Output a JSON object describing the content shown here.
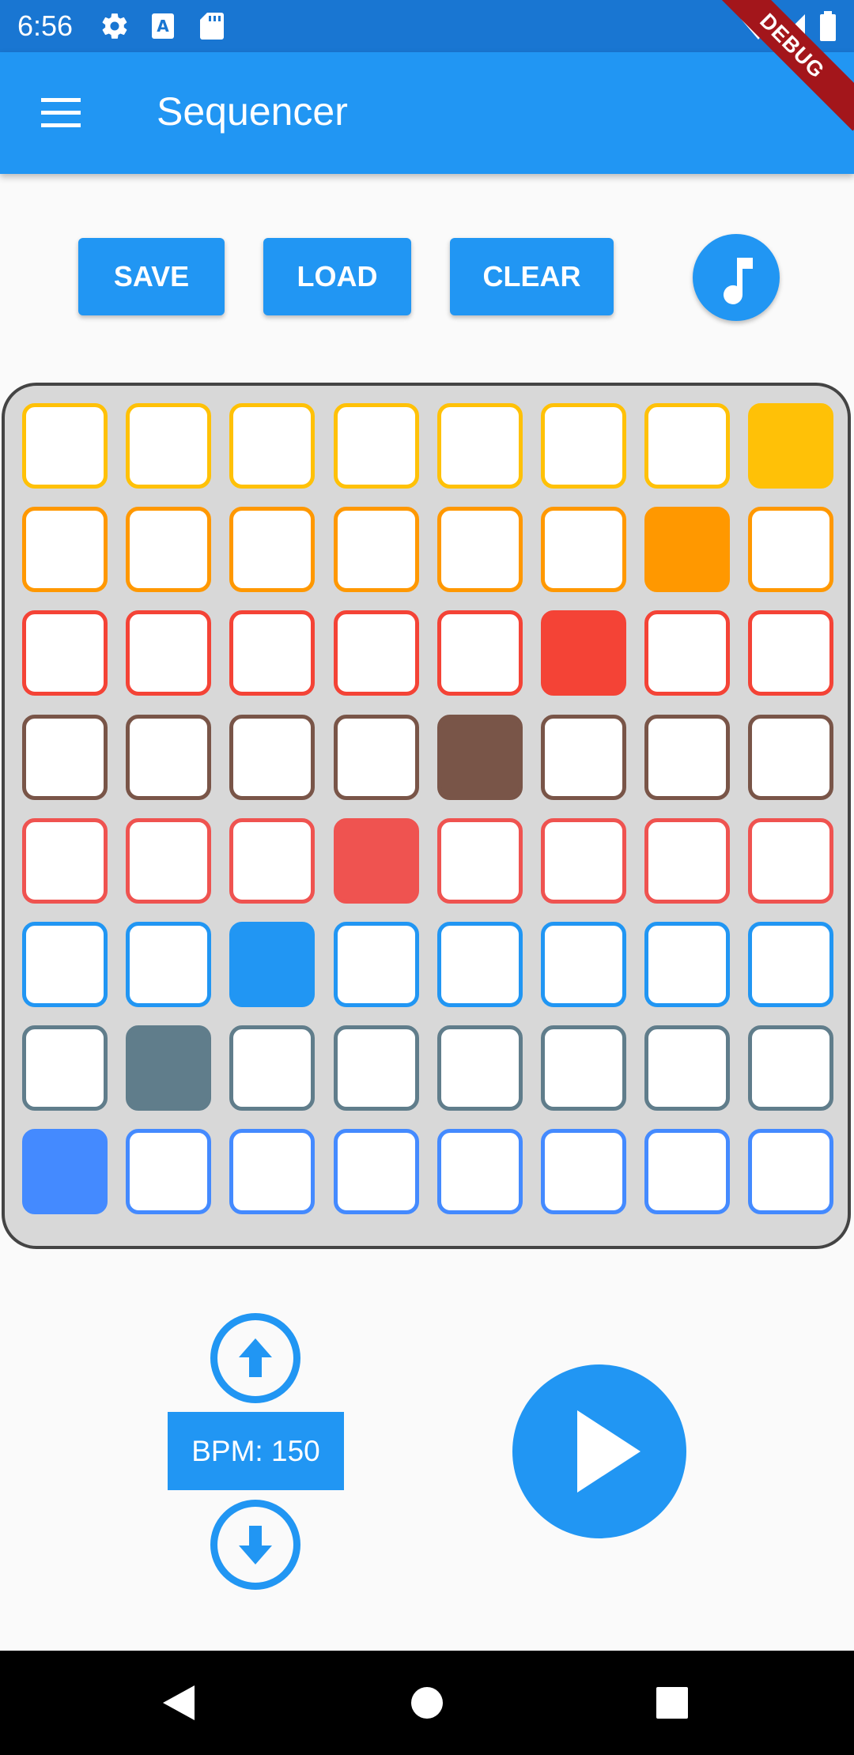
{
  "status_bar": {
    "time": "6:56"
  },
  "app_bar": {
    "title": "Sequencer",
    "debug_banner": "DEBUG"
  },
  "toolbar": {
    "save_label": "SAVE",
    "load_label": "LOAD",
    "clear_label": "CLEAR",
    "music_icon": "music-note-icon"
  },
  "grid": {
    "columns": 8,
    "rows": [
      {
        "color": "#ffc107",
        "active_step": 8
      },
      {
        "color": "#ff9800",
        "active_step": 7
      },
      {
        "color": "#f44336",
        "active_step": 6
      },
      {
        "color": "#795548",
        "active_step": 5
      },
      {
        "color": "#ef5350",
        "active_step": 4
      },
      {
        "color": "#2196f3",
        "active_step": 3
      },
      {
        "color": "#607d8b",
        "active_step": 2
      },
      {
        "color": "#448aff",
        "active_step": 1
      }
    ]
  },
  "tempo": {
    "bpm_label": "BPM: 150",
    "increase_icon": "arrow-up-icon",
    "decrease_icon": "arrow-down-icon"
  },
  "transport": {
    "play_icon": "play-icon"
  },
  "colors": {
    "primary": "#2196f3",
    "primary_dark": "#1976d2"
  }
}
